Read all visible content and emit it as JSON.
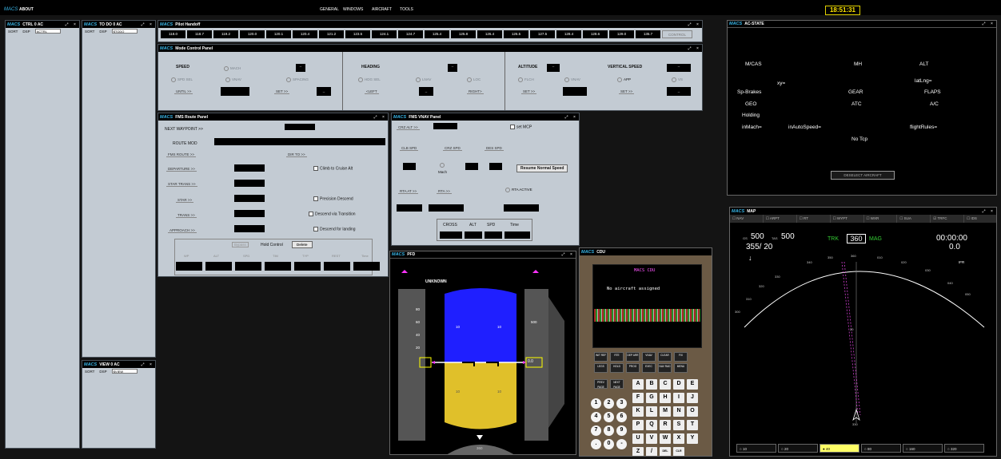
{
  "top": {
    "logo": "MACS",
    "about": "ABOUT",
    "menus": [
      "GENERAL",
      "WINDOWS",
      "AIRCRAFT",
      "TOOLS"
    ],
    "clock": "18:51:31"
  },
  "ctrl": {
    "title": "CTRL 0 AC",
    "sort": "SORT",
    "dsp": "DSP",
    "input": "ACTRL"
  },
  "todo": {
    "title": "TO DO 0 AC",
    "sort": "SORT",
    "dsp": "DSP",
    "input": "$TODO"
  },
  "view": {
    "title": "VIEW 0 AC",
    "sort": "SORT",
    "dsp": "DSP",
    "input": "$VIEW"
  },
  "handoff": {
    "title": "Pilot Handoff",
    "freqs": [
      "118.0",
      "118.7",
      "119.2",
      "120.0",
      "120.1",
      "120.4",
      "121.2",
      "123.5",
      "124.1",
      "124.7",
      "125.4",
      "125.8",
      "126.4",
      "126.5",
      "127.5",
      "128.4",
      "128.6",
      "129.0",
      "135.7"
    ],
    "control": "CONTROL"
  },
  "mcp": {
    "title": "Mode Control Panel",
    "speed": {
      "label": "SPEED",
      "mach": "MACH",
      "spd_sel": "SPD SEL",
      "vnav": "VNAV",
      "spacing": "SPACING",
      "until": "UNTIL >>",
      "set": "SET >>",
      "val": "--"
    },
    "heading": {
      "label": "HEADING",
      "hdg_sel": "HDG SEL",
      "lnav": "LNAV",
      "loc": "LOC",
      "left": "<LEFT",
      "right": "RIGHT>",
      "val": "--"
    },
    "altitude": {
      "label": "ALTITUDE",
      "flch": "FLCH",
      "vnav": "VNAV",
      "set": "SET >>",
      "val": "--"
    },
    "vs": {
      "label": "VERTICAL SPEED",
      "app": "APP",
      "vs": "VS",
      "set": "SET >>",
      "val": "--"
    }
  },
  "route": {
    "title": "FMS Route Panel",
    "next_wp": "NEXT WAYPOINT >>",
    "route_mod": "ROUTE MOD",
    "fms_route": "FMS ROUTE >>",
    "dir_to": "DIR TO >>",
    "departure": "DEPARTURE >>",
    "climb": "Climb to Cruise Alt",
    "star_trans": "STAR TRANS >>",
    "star": "STAR >>",
    "precision": "Precision Descend",
    "trans": "TRANS >>",
    "descend_trans": "Descend via Transition",
    "approach": "APPROACH >>",
    "descend_land": "Descend for landing",
    "bypass": "Bypass",
    "hold": "Hold Control",
    "delete": "Delete",
    "cols": [
      "WP",
      "ALT",
      "SPD",
      "TIM",
      "TYP",
      "REST",
      "Time"
    ]
  },
  "vnav": {
    "title": "FMS VNAV Panel",
    "crz_alt": "CRZ ALT >>",
    "set_mcp": "set MCP",
    "clb": "CLB SPD",
    "crz": "CRZ SPD",
    "des": "DES SPD",
    "mach": "Mach",
    "resume": "Resume Normal Speed",
    "rta_at": "RTA AT >>",
    "rta": "RTA >>",
    "rta_active": "RTA ACTIVE",
    "cross": "CROSS",
    "alt": "ALT",
    "spd": "SPD",
    "time": "Time"
  },
  "acstate": {
    "title": "AC-STATE",
    "mcas": "M/CAS",
    "mh": "MH",
    "alt": "ALT",
    "xy": "xy=",
    "latlng": "latLng=",
    "spbrakes": "Sp-Brakes",
    "gear": "GEAR",
    "flaps": "FLAPS",
    "geo": "GEO",
    "atc": "ATC",
    "ac": "A/C",
    "holding": "Holding",
    "inmach": "inMach=",
    "inauto": "inAutoSpeed=",
    "flightrules": "flightRules=",
    "notcp": "No Tcp",
    "deselect": "DESELECT AIRCRAFT"
  },
  "pfd": {
    "title": "PFD",
    "unknown": "UNKNOWN",
    "speed_ticks": [
      "80",
      "60",
      "40",
      "20"
    ],
    "pitch_up": [
      "10",
      "10"
    ],
    "pitch_dn": [
      "10",
      "10"
    ],
    "alt_val": "0.0",
    "hdg": "360",
    "vsi": "500"
  },
  "cdu": {
    "title": "CDU",
    "header": "MACS CDU",
    "msg": "No aircraft assigned",
    "fkeys": [
      "INIT REF",
      "RTE",
      "DEP ARR",
      "VNAV",
      "CLEAR",
      "FIX",
      "LEGS",
      "HOLD",
      "PROG",
      "EXEC",
      "MENU",
      "NAV RAD",
      "PREV PAGE",
      "NEXT PAGE"
    ],
    "letters": [
      "A",
      "B",
      "C",
      "D",
      "E",
      "F",
      "G",
      "H",
      "I",
      "J",
      "K",
      "L",
      "M",
      "N",
      "O",
      "P",
      "Q",
      "R",
      "S",
      "T",
      "U",
      "V",
      "W",
      "X",
      "Y",
      "Z",
      "/",
      "DEL",
      "CLR"
    ],
    "digits": [
      "1",
      "2",
      "3",
      "4",
      "5",
      "6",
      "7",
      "8",
      "9",
      ".",
      "0",
      "-"
    ]
  },
  "map": {
    "title": "MAP",
    "filters": [
      "NAV",
      "ARPT",
      "RT",
      "WYPT",
      "WXR",
      "SUA",
      "TRFC",
      "IDS"
    ],
    "gs_lbl": "GS",
    "gs": "500",
    "tas_lbl": "TAS",
    "tas": "500",
    "wind": "355/ 20",
    "trk": "TRK",
    "hdg": "360",
    "mag": "MAG",
    "time": "00:00:00",
    "time2": "0.0",
    "ifr": "IFR",
    "ac": "330",
    "ranges": [
      "10",
      "20",
      "40",
      "80",
      "160",
      "320"
    ],
    "ticks": [
      "330",
      "340",
      "350",
      "360",
      "010",
      "020",
      "030",
      "040",
      "050",
      "300",
      "310",
      "320"
    ],
    "range_mark": "20"
  },
  "colors": {
    "cyan": "#38b6e8",
    "sky": "#1f1fff",
    "ground": "#e0c02a",
    "magenta": "#ff33ff"
  }
}
